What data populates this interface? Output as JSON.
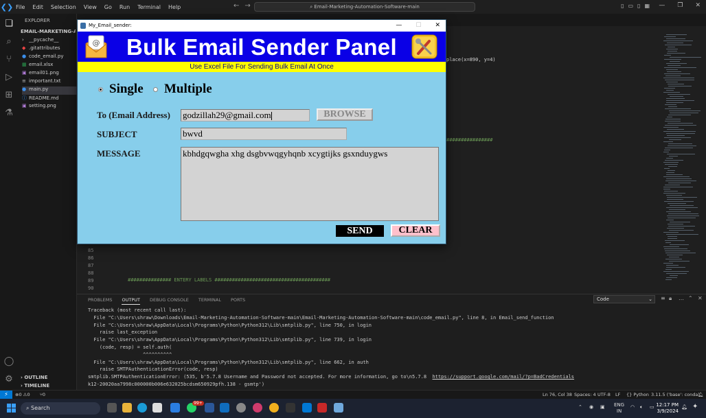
{
  "vscode": {
    "menu": [
      "File",
      "Edit",
      "Selection",
      "View",
      "Go",
      "Run",
      "Terminal",
      "Help"
    ],
    "search": "Email-Marketing-Automation-Software-main",
    "explorer_title": "EXPLORER",
    "project": "EMAIL-MARKETING-AUTO...",
    "files": [
      {
        "name": "__pycache__",
        "icon": "chevron-right"
      },
      {
        "name": ".gitattributes",
        "icon": "git-icon"
      },
      {
        "name": "code_email.py",
        "icon": "python-icon"
      },
      {
        "name": "email.xlsx",
        "icon": "excel-icon"
      },
      {
        "name": "email01.png",
        "icon": "image-icon"
      },
      {
        "name": "important.txt",
        "icon": "text-icon"
      },
      {
        "name": "main.py",
        "icon": "python-icon",
        "selected": true
      },
      {
        "name": "README.md",
        "icon": "info-icon"
      },
      {
        "name": "setting.png",
        "icon": "image-icon"
      }
    ],
    "outline": "OUTLINE",
    "timeline": "TIMELINE",
    "code_fragments": {
      "place": "place(x=890, y=4)",
      "hashes": "################",
      "entry_labels": "############### ENTERY LABELS ########################################"
    },
    "line_numbers": [
      "85",
      "86",
      "87",
      "88",
      "89",
      "90"
    ],
    "panel_tabs": [
      "PROBLEMS",
      "OUTPUT",
      "DEBUG CONSOLE",
      "TERMINAL",
      "PORTS"
    ],
    "panel_active": "OUTPUT",
    "output_channel": "Code",
    "output_lines": [
      "Traceback (most recent call last):",
      "  File \"C:\\Users\\shraw\\Downloads\\Email-Marketing-Automation-Software-main\\Email-Marketing-Automation-Software-main\\code_email.py\", line 8, in Email_send_function",
      "  File \"C:\\Users\\shraw\\AppData\\Local\\Programs\\Python\\Python312\\Lib\\smtplib.py\", line 750, in login",
      "    raise last_exception",
      "  File \"C:\\Users\\shraw\\AppData\\Local\\Programs\\Python\\Python312\\Lib\\smtplib.py\", line 739, in login",
      "    (code, resp) = self.auth(",
      "                   ^^^^^^^^^^",
      "  File \"C:\\Users\\shraw\\AppData\\Local\\Programs\\Python\\Python312\\Lib\\smtplib.py\", line 662, in auth",
      "    raise SMTPAuthenticationError(code, resp)"
    ],
    "error_line_prefix": "smtplib.SMTPAuthenticationError: (535, b'5.7.8 Username and Password not accepted. For more information, go to\\n5.7.8  ",
    "error_link": "https://support.google.com/mail/?p=BadCredentials",
    "error_line2": "k12-20020aa7998c000000b006e632025bcdsm650929pfh.138 - gsmtp')",
    "status": {
      "errors": "0",
      "warnings": "0",
      "ports": "0",
      "position": "Ln 76, Col 38",
      "spaces": "Spaces: 4",
      "encoding": "UTF-8",
      "eol": "LF",
      "language": "Python",
      "interpreter": "3.11.5 ('base': conda)"
    }
  },
  "taskbar": {
    "search": "Search",
    "lang": "ENG",
    "region": "IN",
    "time": "12:17 PM",
    "date": "3/9/2024",
    "badge": "99+"
  },
  "app": {
    "window_title": "My_Email_sender:",
    "banner_title": "Bulk Email Sender Panel",
    "subtitle": "Use Excel File For Sending Bulk Email At Once",
    "radio_single": "Single",
    "radio_multiple": "Multiple",
    "label_to": "To (Email Address)",
    "label_subject": "SUBJECT",
    "label_message": "MESSAGE",
    "to_value": "godzillah29@gmail.com",
    "subject_value": "bwvd",
    "message_value": "kbhdgqwgha xhg dsgbvwqgyhqnb xcygtijks gsxnduygws",
    "browse": "BROWSE",
    "send": "SEND",
    "clear": "CLEAR",
    "selected_mode": "Single"
  },
  "colors": {
    "window_bg": "#87ceeb",
    "banner_bg": "#0a00e6",
    "subbar_bg": "#ffff00",
    "send_bg": "#000000",
    "clear_bg": "#ffc0cb"
  }
}
